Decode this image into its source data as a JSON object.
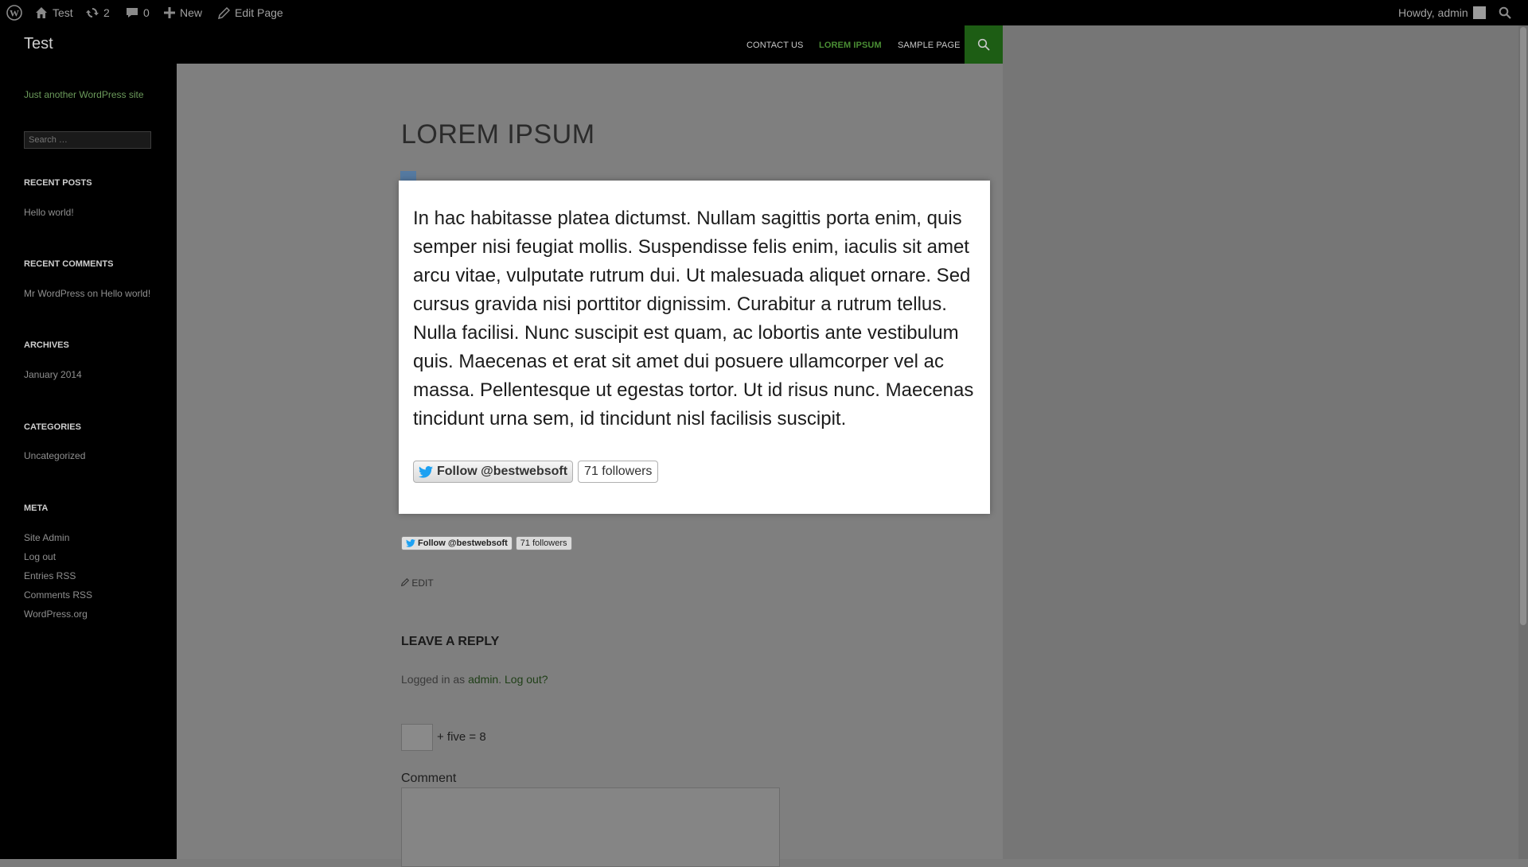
{
  "adminbar": {
    "site_name": "Test",
    "updates_count": "2",
    "comments_count": "0",
    "new_label": "New",
    "edit_label": "Edit Page",
    "howdy": "Howdy, admin"
  },
  "header": {
    "site_title": "Test",
    "tagline": "Just another WordPress site",
    "nav": [
      "CONTACT US",
      "LOREM IPSUM",
      "SAMPLE PAGE"
    ],
    "active_nav_color": "#4a8e34"
  },
  "sidebar": {
    "search_placeholder": "Search …",
    "recent_posts": {
      "title": "RECENT POSTS",
      "items": [
        "Hello world!"
      ]
    },
    "recent_comments": {
      "title": "RECENT COMMENTS",
      "author": "Mr WordPress",
      "on": "on",
      "post": "Hello world!"
    },
    "archives": {
      "title": "ARCHIVES",
      "items": [
        "January 2014"
      ]
    },
    "categories": {
      "title": "CATEGORIES",
      "items": [
        "Uncategorized"
      ]
    },
    "meta": {
      "title": "META",
      "items": [
        "Site Admin",
        "Log out",
        "Entries RSS",
        "Comments RSS",
        "WordPress.org"
      ]
    }
  },
  "page": {
    "title": "LOREM IPSUM",
    "follow_small": {
      "label": "Follow @bestwebsoft",
      "followers": "71 followers"
    },
    "edit_label": "EDIT",
    "reply_title": "LEAVE A REPLY",
    "logged_in_prefix": "Logged in as",
    "logged_in_user": "admin",
    "logout_label": "Log out?",
    "captcha_text": "+ five = 8",
    "comment_label": "Comment"
  },
  "modal": {
    "text": "In hac habitasse platea dictumst. Nullam sagittis porta enim, quis semper nisi feugiat mollis. Suspendisse felis enim, iaculis sit amet arcu vitae, vulputate rutrum dui. Ut malesuada aliquet ornare. Sed cursus gravida nisi porttitor dignissim. Curabitur a rutrum tellus. Nulla facilisi. Nunc suscipit est quam, ac lobortis ante vestibulum quis. Maecenas et erat sit amet dui posuere ullamcorper vel ac massa. Pellentesque ut egestas tortor. Ut id risus nunc. Maecenas tincidunt urna sem, id tincidunt nisl facilisis suscipit.",
    "follow_label": "Follow @bestwebsoft",
    "followers": "71 followers"
  },
  "colors": {
    "twitter_blue": "#1da1f2",
    "accent_green": "#24890d"
  }
}
